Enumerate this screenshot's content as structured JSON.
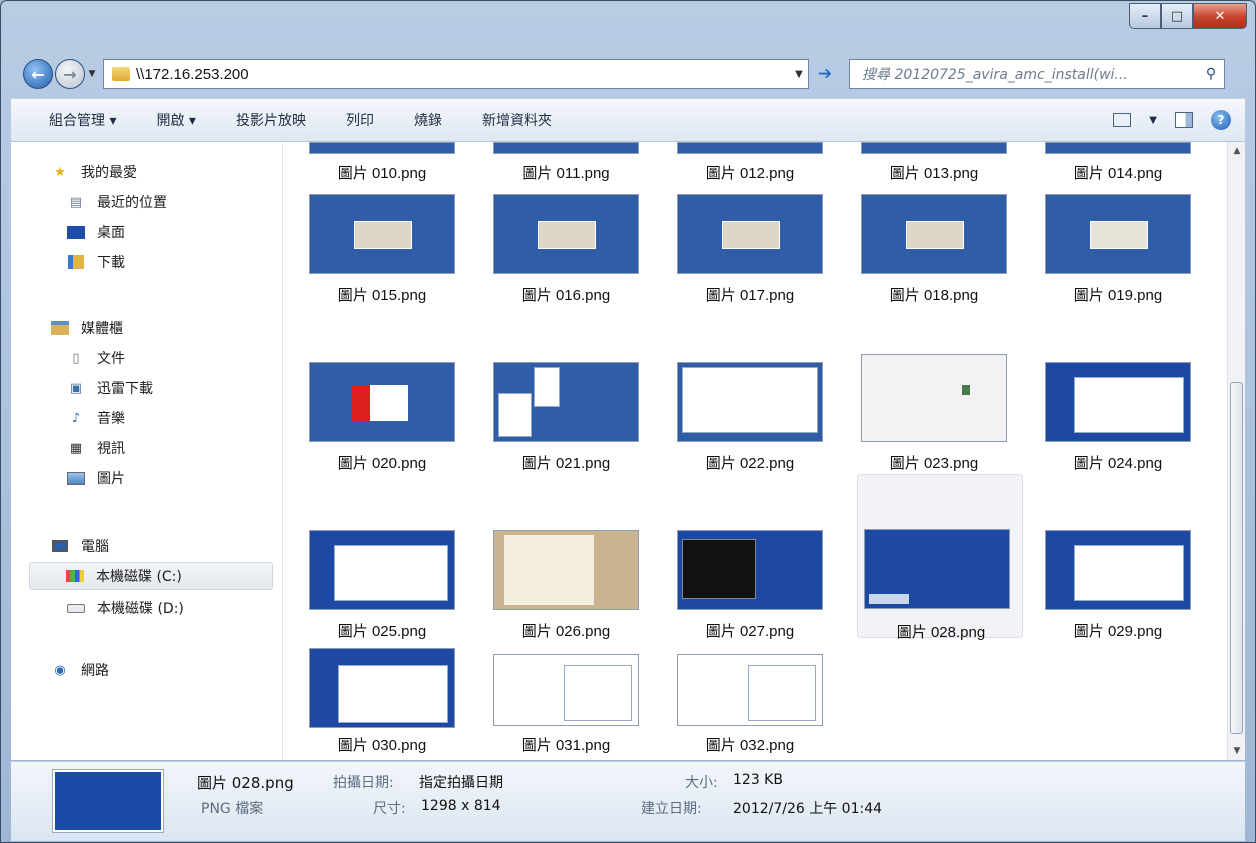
{
  "address": "\\\\172.16.253.200",
  "search_placeholder": "搜尋 20120725_avira_amc_install(wi...",
  "toolbar": {
    "organize": "組合管理 ▾",
    "open": "開啟 ▾",
    "slideshow": "投影片放映",
    "print": "列印",
    "burn": "燒錄",
    "new_folder": "新增資料夾"
  },
  "sidebar": {
    "favorites": "我的最愛",
    "recent": "最近的位置",
    "desktop": "桌面",
    "downloads": "下載",
    "libraries": "媒體櫃",
    "documents": "文件",
    "thunder": "迅雷下載",
    "music": "音樂",
    "videos": "視訊",
    "pictures": "圖片",
    "computer": "電腦",
    "drive_c": "本機磁碟 (C:)",
    "drive_d": "本機磁碟 (D:)",
    "network": "網路"
  },
  "files": [
    "圖片 010.png",
    "圖片 011.png",
    "圖片 012.png",
    "圖片 013.png",
    "圖片 014.png",
    "圖片 015.png",
    "圖片 016.png",
    "圖片 017.png",
    "圖片 018.png",
    "圖片 019.png",
    "圖片 020.png",
    "圖片 021.png",
    "圖片 022.png",
    "圖片 023.png",
    "圖片 024.png",
    "圖片 025.png",
    "圖片 026.png",
    "圖片 027.png",
    "圖片 028.png",
    "圖片 029.png",
    "圖片 030.png",
    "圖片 031.png",
    "圖片 032.png"
  ],
  "details": {
    "name": "圖片 028.png",
    "type": "PNG 檔案",
    "date_taken_label": "拍攝日期:",
    "date_taken_value": "指定拍攝日期",
    "dimensions_label": "尺寸:",
    "dimensions_value": "1298 x 814",
    "size_label": "大小:",
    "size_value": "123 KB",
    "created_label": "建立日期:",
    "created_value": "2012/7/26 上午 01:44"
  }
}
